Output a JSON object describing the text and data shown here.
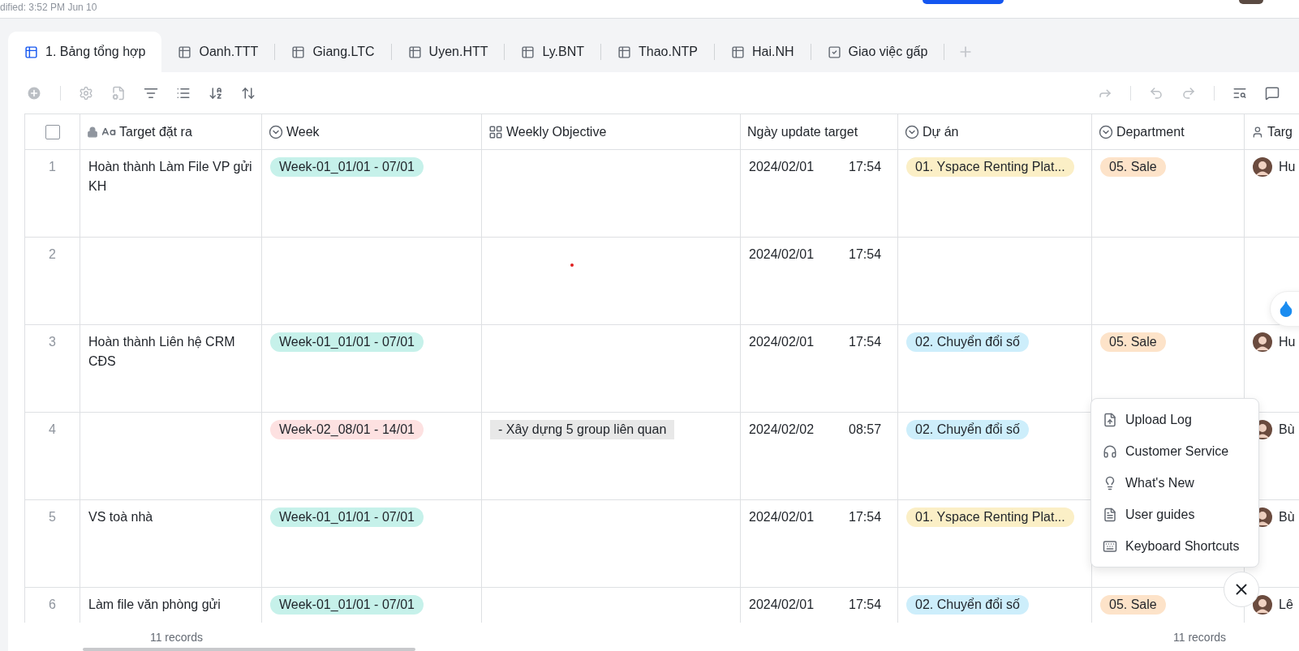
{
  "header": {
    "modified_text": "dified: 3:52 PM Jun 10"
  },
  "tabs": [
    {
      "label": "1. Bảng tổng hợp",
      "kind": "grid",
      "selected": true
    },
    {
      "label": "Oanh.TTT",
      "kind": "grid",
      "selected": false
    },
    {
      "label": "Giang.LTC",
      "kind": "grid",
      "selected": false
    },
    {
      "label": "Uyen.HTT",
      "kind": "grid",
      "selected": false
    },
    {
      "label": "Ly.BNT",
      "kind": "grid",
      "selected": false
    },
    {
      "label": "Thao.NTP",
      "kind": "grid",
      "selected": false
    },
    {
      "label": "Hai.NH",
      "kind": "grid",
      "selected": false
    },
    {
      "label": "Giao việc gấp",
      "kind": "form",
      "selected": false
    }
  ],
  "table": {
    "select_all_checked": false,
    "columns": [
      {
        "label": "Target đặt ra",
        "kind": "text",
        "locked": true
      },
      {
        "label": "Week",
        "kind": "select",
        "locked": false
      },
      {
        "label": "Weekly Objective",
        "kind": "lookup",
        "locked": false
      },
      {
        "label": "Ngày update target",
        "kind": "date",
        "locked": false
      },
      {
        "label": "Dự án",
        "kind": "select",
        "locked": false
      },
      {
        "label": "Department",
        "kind": "select",
        "locked": false
      },
      {
        "label": "Targ",
        "kind": "person",
        "locked": false
      }
    ],
    "rows": [
      {
        "index": "1",
        "target": "Hoàn thành Làm File VP gửi KH",
        "week": {
          "text": "Week-01_01/01 - 07/01",
          "color": "#c6f1ea"
        },
        "date": "2024/02/01",
        "time": "17:54",
        "project": {
          "text": "01. Yspace Renting Plat...",
          "color": "#fbefc6"
        },
        "department": {
          "text": "05. Sale",
          "color": "#fde3c9"
        },
        "owner": "Hu"
      },
      {
        "index": "2",
        "date": "2024/02/01",
        "time": "17:54"
      },
      {
        "index": "3",
        "target": "Hoàn thành Liên hệ CRM CĐS",
        "week": {
          "text": "Week-01_01/01 - 07/01",
          "color": "#c6f1ea"
        },
        "date": "2024/02/01",
        "time": "17:54",
        "project": {
          "text": "02. Chuyển đổi số",
          "color": "#cdeefb"
        },
        "department": {
          "text": "05. Sale",
          "color": "#fde3c9"
        },
        "owner": "Hu"
      },
      {
        "index": "4",
        "week": {
          "text": "Week-02_08/01 - 14/01",
          "color": "#fde1e1"
        },
        "objective": "- Xây dựng 5 group liên quan",
        "date": "2024/02/02",
        "time": "08:57",
        "project": {
          "text": "02. Chuyển đổi số",
          "color": "#cdeefb"
        },
        "owner": "Bù"
      },
      {
        "index": "5",
        "target": "VS toà nhà",
        "week": {
          "text": "Week-01_01/01 - 07/01",
          "color": "#c6f1ea"
        },
        "date": "2024/02/01",
        "time": "17:54",
        "project": {
          "text": "01. Yspace Renting Plat...",
          "color": "#fbefc6"
        },
        "owner": "Bù"
      },
      {
        "index": "6",
        "target": "Làm file văn phòng gửi",
        "week": {
          "text": "Week-01_01/01 - 07/01",
          "color": "#c6f1ea"
        },
        "date": "2024/02/01",
        "time": "17:54",
        "project": {
          "text": "02. Chuyển đổi số",
          "color": "#cdeefb"
        },
        "department": {
          "text": "05. Sale",
          "color": "#fde3c9"
        },
        "owner": "Lê"
      }
    ]
  },
  "footer": {
    "left_count": "11 records",
    "right_count": "11 records"
  },
  "help_menu": {
    "items": [
      {
        "label": "Upload Log",
        "kind": "upload"
      },
      {
        "label": "Customer Service",
        "kind": "headset"
      },
      {
        "label": "What's New",
        "kind": "bulb"
      },
      {
        "label": "User guides",
        "kind": "doc"
      },
      {
        "label": "Keyboard Shortcuts",
        "kind": "keyboard"
      }
    ]
  }
}
